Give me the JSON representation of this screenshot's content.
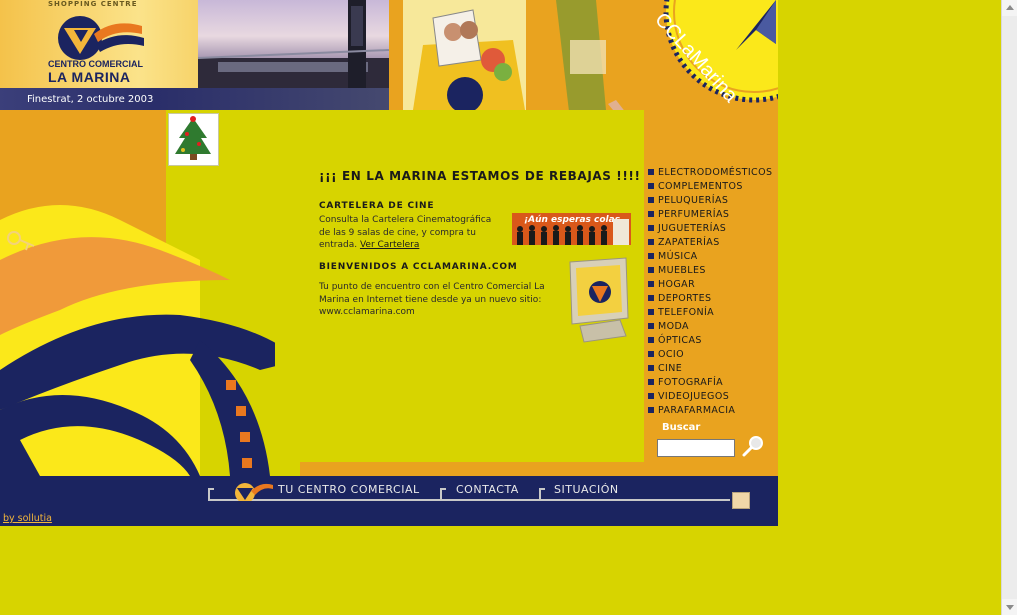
{
  "header": {
    "logo": {
      "tagline": "SHOPPING CENTRE",
      "name_line1": "CENTRO COMERCIAL",
      "name_line2": "LA MARINA"
    },
    "date": "Finestrat, 2 octubre 2003",
    "brand": "CCLaMarina"
  },
  "main": {
    "headline": "¡¡¡ EN LA MARINA ESTAMOS DE REBAJAS !!!!",
    "cinema": {
      "title": "CARTELERA DE CINE",
      "body_line1": "Consulta la Cartelera Cinematográfica",
      "body_line2": "de las 9 salas de cine, y compra tu",
      "body_line3": "entrada.",
      "link": "Ver Cartelera",
      "banner": "¡Aún esperas colas"
    },
    "welcome": {
      "title": "BIENVENIDOS A CCLAMARINA.COM",
      "body_line1": "Tu punto de encuentro con el Centro Comercial La",
      "body_line2": "Marina en Internet tiene desde ya un nuevo sitio:",
      "body_line3": "www.cclamarina.com"
    }
  },
  "nav": {
    "items": [
      "ELECTRODOMÉSTICOS",
      "COMPLEMENTOS",
      "PELUQUERÍAS",
      "PERFUMERÍAS",
      "JUGUETERÍAS",
      "ZAPATERÍAS",
      "MÚSICA",
      "MUEBLES",
      "HOGAR",
      "DEPORTES",
      "TELEFONÍA",
      "MODA",
      "ÓPTICAS",
      "OCIO",
      "CINE",
      "FOTOGRAFÍA",
      "VIDEOJUEGOS",
      "PARAFARMACIA"
    ],
    "search_label": "Buscar",
    "search_value": ""
  },
  "footer": {
    "links": {
      "centro": "TU CENTRO COMERCIAL",
      "contacta": "CONTACTA",
      "situacion": "SITUACIÓN"
    },
    "credit": "by sollutia"
  },
  "colors": {
    "page_bg": "#d7d400",
    "orange": "#e9a31f",
    "navy": "#1b2460"
  }
}
